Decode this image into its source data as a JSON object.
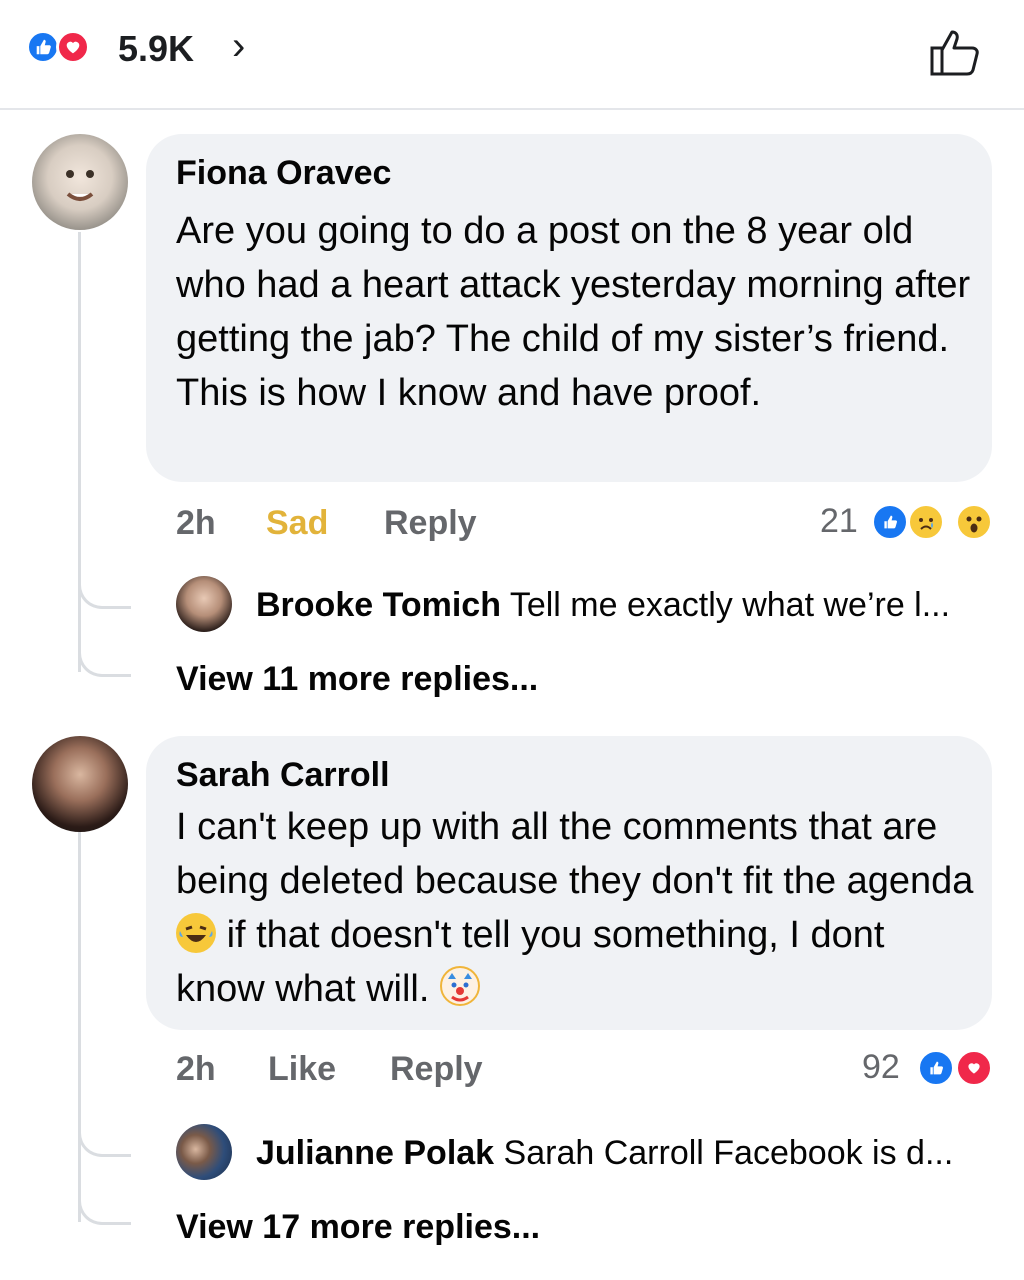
{
  "header": {
    "reaction_count": "5.9K",
    "chevron": "›",
    "reactions": [
      "like-icon",
      "love-icon"
    ],
    "like_button_icon": "thumbs-up-outline-icon"
  },
  "comments": [
    {
      "author": "Fiona Oravec",
      "text": "Are you going to do a post on the 8 year old who had a heart attack yesterday morning after getting the jab? The child of my sister’s friend. This is how I know and have proof.",
      "time": "2h",
      "reaction_label": "Sad",
      "reply_label": "Reply",
      "reaction_count": "21",
      "reactions": [
        "like-icon",
        "sad-icon",
        "wow-icon"
      ],
      "reply_preview": {
        "author": "Brooke Tomich",
        "text": "Tell me exactly what we’re l..."
      },
      "more_replies": "View 11 more replies..."
    },
    {
      "author": "Sarah Carroll",
      "text_part1": "I can't keep up with all the comments that are being deleted because they don't fit the agenda",
      "text_part2": "if that doesn't tell you something, I dont know what will.",
      "time": "2h",
      "reaction_label": "Like",
      "reply_label": "Reply",
      "reaction_count": "92",
      "reactions": [
        "like-icon",
        "love-icon"
      ],
      "reply_preview": {
        "author": "Julianne Polak",
        "text": "Sarah Carroll Facebook is d..."
      },
      "more_replies": "View 17 more replies..."
    }
  ],
  "colors": {
    "like": "#1877f2",
    "love": "#f0284a",
    "sad_label": "#e2b33a",
    "bubble": "#f0f2f5",
    "meta": "#65676b"
  }
}
